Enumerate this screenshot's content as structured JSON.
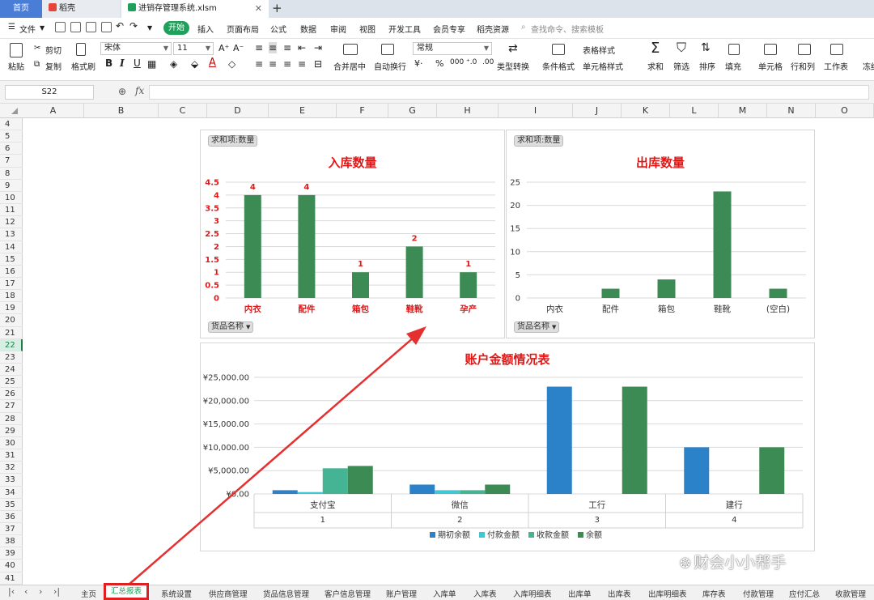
{
  "titlebar": {
    "home_tab": "首页",
    "daoke_tab": "稻壳",
    "file_tab": "进销存管理系统.xlsm",
    "close": "✕",
    "new_tab": "+"
  },
  "menubar": {
    "file_menu": "文件",
    "start": "开始",
    "items": [
      "插入",
      "页面布局",
      "公式",
      "数据",
      "审阅",
      "视图",
      "开发工具",
      "会员专享",
      "稻壳资源"
    ],
    "search": "查找命令、搜索模板"
  },
  "ribbon": {
    "paste": "粘贴",
    "cut": "剪切",
    "copy": "复制",
    "format_painter": "格式刷",
    "font_name": "宋体",
    "font_size": "11",
    "bold": "B",
    "italic": "I",
    "underline": "U",
    "merge_center": "合并居中",
    "wrap_text": "自动换行",
    "number_format": "常规",
    "type_convert": "类型转换",
    "cond_format": "条件格式",
    "table_style": "表格样式",
    "cell_style": "单元格样式",
    "sum": "求和",
    "filter": "筛选",
    "sort": "排序",
    "fill": "填充",
    "cell": "单元格",
    "row_col": "行和列",
    "worksheet": "工作表",
    "freeze": "冻结"
  },
  "formula_bar": {
    "name_box": "S22",
    "fx": "fx",
    "value": ""
  },
  "columns": [
    "A",
    "B",
    "C",
    "D",
    "E",
    "F",
    "G",
    "H",
    "I",
    "J",
    "K",
    "L",
    "M",
    "N",
    "O"
  ],
  "rows": [
    "4",
    "5",
    "6",
    "7",
    "8",
    "9",
    "10",
    "11",
    "12",
    "13",
    "14",
    "15",
    "16",
    "17",
    "18",
    "19",
    "20",
    "21",
    "22",
    "23",
    "24",
    "25",
    "26",
    "27",
    "28",
    "29",
    "30",
    "31",
    "32",
    "33",
    "34",
    "35",
    "36",
    "37",
    "38",
    "39",
    "40",
    "41"
  ],
  "active_row": "22",
  "chart_data": [
    {
      "type": "bar",
      "title": "入库数量",
      "field_button": "求和项:数量",
      "axis_button": "货品名称",
      "categories": [
        "内衣",
        "配件",
        "箱包",
        "鞋靴",
        "孕产"
      ],
      "values": [
        4,
        4,
        1,
        2,
        1
      ],
      "data_labels": [
        "4",
        "4",
        "1",
        "2",
        "1"
      ],
      "yticks": [
        "0",
        "0.5",
        "1",
        "1.5",
        "2",
        "2.5",
        "3",
        "3.5",
        "4",
        "4.5"
      ],
      "ylim": [
        0,
        4.5
      ],
      "bar_color": "#3d8b54",
      "label_color": "#e01818",
      "grid": true
    },
    {
      "type": "bar",
      "title": "出库数量",
      "field_button": "求和项:数量",
      "categories": [
        "内衣",
        "配件",
        "箱包",
        "鞋靴",
        "(空白)"
      ],
      "values": [
        0,
        2,
        4,
        23,
        2
      ],
      "yticks": [
        "0",
        "5",
        "10",
        "15",
        "20",
        "25"
      ],
      "ylim": [
        0,
        25
      ],
      "bar_color": "#3d8b54",
      "grid": true
    },
    {
      "type": "bar",
      "title": "账户金额情况表",
      "categories": [
        "支付宝",
        "微信",
        "工行",
        "建行"
      ],
      "category_numbers": [
        "1",
        "2",
        "3",
        "4"
      ],
      "series": [
        {
          "name": "期初余额",
          "values": [
            800,
            2000,
            23000,
            10000
          ],
          "color": "#2b82c8"
        },
        {
          "name": "付款金额",
          "values": [
            400,
            800,
            0,
            0
          ],
          "color": "#3fc7d4"
        },
        {
          "name": "收款金额",
          "values": [
            5500,
            800,
            0,
            0
          ],
          "color": "#45b494"
        },
        {
          "name": "余额",
          "values": [
            6000,
            2000,
            23000,
            10000
          ],
          "color": "#3d8b54"
        }
      ],
      "yticks": [
        "¥0.00",
        "¥5,000.00",
        "¥10,000.00",
        "¥15,000.00",
        "¥20,000.00",
        "¥25,000.00"
      ],
      "ylim": [
        0,
        25000
      ],
      "legend": "bottom",
      "grid": true
    }
  ],
  "sheets": [
    "主页",
    "汇总报表",
    "系统设置",
    "供应商管理",
    "货品信息管理",
    "客户信息管理",
    "账户管理",
    "入库单",
    "入库表",
    "入库明细表",
    "出库单",
    "出库表",
    "出库明细表",
    "库存表",
    "付款管理",
    "应付汇总",
    "收款管理"
  ],
  "active_sheet": "汇总报表",
  "watermark": "财会小小帮手",
  "colors": {
    "accent_green": "#1fa05b",
    "annotation_red": "#e02020",
    "bar_green": "#3d8b54"
  }
}
